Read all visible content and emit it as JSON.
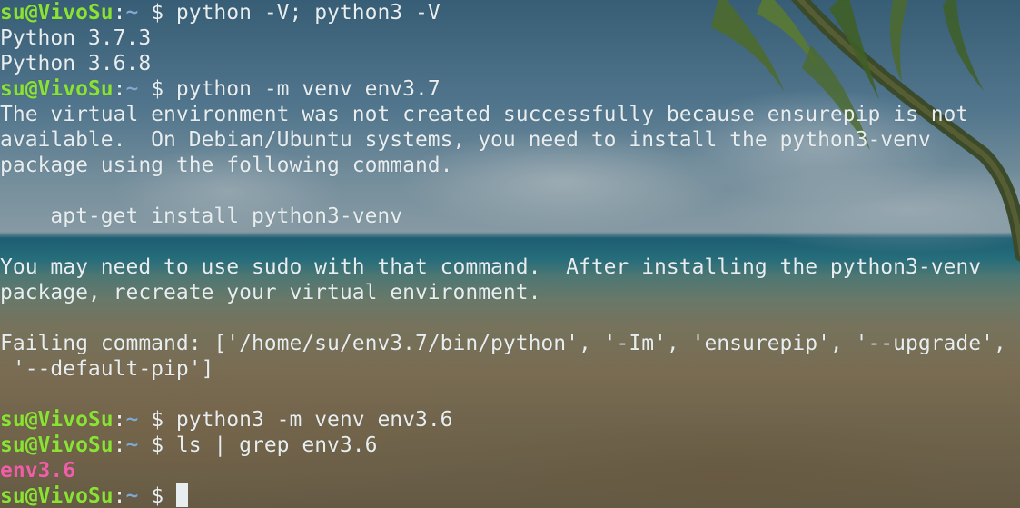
{
  "terminal": {
    "prompt": {
      "user_host": "su@VivoSu",
      "sep": ":",
      "path": "~",
      "dollar": " $ "
    },
    "lines": [
      {
        "type": "prompt",
        "command": "python -V; python3 -V"
      },
      {
        "type": "output",
        "text": "Python 3.7.3"
      },
      {
        "type": "output",
        "text": "Python 3.6.8"
      },
      {
        "type": "prompt",
        "command": "python -m venv env3.7"
      },
      {
        "type": "output",
        "text": "The virtual environment was not created successfully because ensurepip is not"
      },
      {
        "type": "output",
        "text": "available.  On Debian/Ubuntu systems, you need to install the python3-venv"
      },
      {
        "type": "output",
        "text": "package using the following command."
      },
      {
        "type": "output",
        "text": ""
      },
      {
        "type": "output",
        "text": "    apt-get install python3-venv"
      },
      {
        "type": "output",
        "text": ""
      },
      {
        "type": "output",
        "text": "You may need to use sudo with that command.  After installing the python3-venv"
      },
      {
        "type": "output",
        "text": "package, recreate your virtual environment."
      },
      {
        "type": "output",
        "text": ""
      },
      {
        "type": "output",
        "text": "Failing command: ['/home/su/env3.7/bin/python', '-Im', 'ensurepip', '--upgrade',"
      },
      {
        "type": "output",
        "text": " '--default-pip']"
      },
      {
        "type": "output",
        "text": ""
      },
      {
        "type": "prompt",
        "command": "python3 -m venv env3.6"
      },
      {
        "type": "prompt",
        "command": "ls | grep env3.6"
      },
      {
        "type": "dir",
        "text": "env3.6"
      },
      {
        "type": "prompt_cursor",
        "command": ""
      }
    ]
  },
  "colors": {
    "prompt_user": "#8ae234",
    "prompt_path": "#7fa7d0",
    "text": "#e8eef0",
    "dir_highlight": "#ef5fa8"
  }
}
